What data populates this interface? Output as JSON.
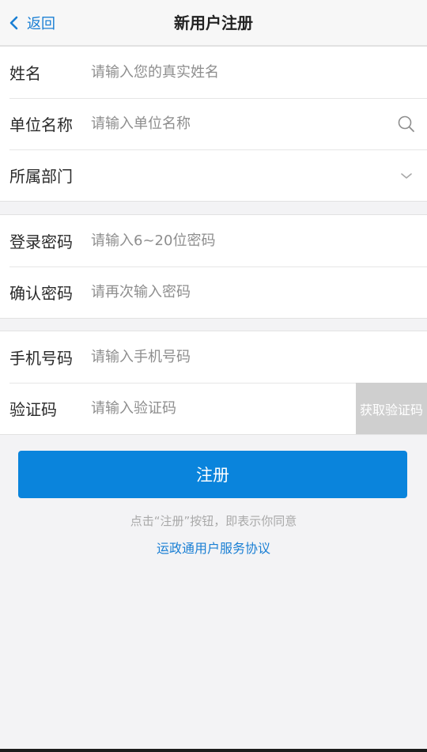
{
  "header": {
    "back_label": "返回",
    "title": "新用户注册"
  },
  "form": {
    "name_label": "姓名",
    "name_placeholder": "请输入您的真实姓名",
    "unit_label": "单位名称",
    "unit_placeholder": "请输入单位名称",
    "dept_label": "所属部门",
    "password_label": "登录密码",
    "password_placeholder": "请输入6~20位密码",
    "confirm_label": "确认密码",
    "confirm_placeholder": "请再次输入密码",
    "phone_label": "手机号码",
    "phone_placeholder": "请输入手机号码",
    "code_label": "验证码",
    "code_placeholder": "请输入验证码",
    "get_code_label": "获取验证码"
  },
  "actions": {
    "submit_label": "注册",
    "agree_note": "点击“注册”按钮，即表示你同意",
    "agree_link": "运政通用户服务协议"
  },
  "colors": {
    "accent": "#0a84dc",
    "link": "#1a7fd4",
    "background": "#f3f3f5",
    "code_button": "#cfcfcf"
  },
  "icons": {
    "back": "chevron-left-icon",
    "search": "search-icon",
    "dropdown": "chevron-down-icon"
  }
}
